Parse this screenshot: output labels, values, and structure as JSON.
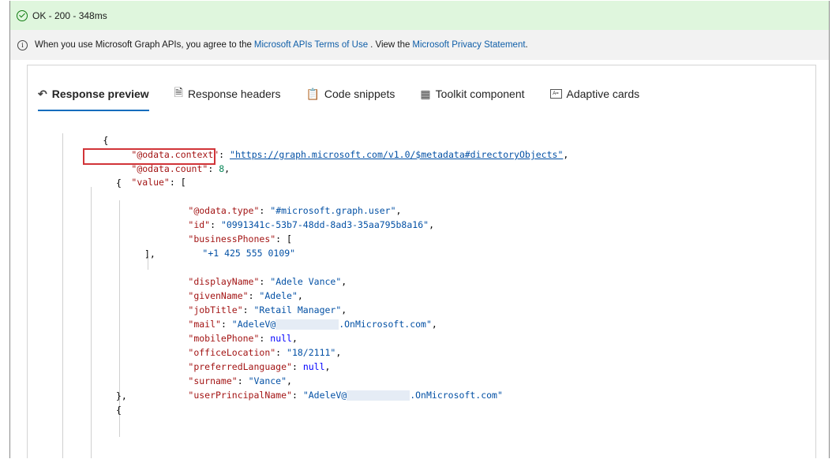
{
  "status": {
    "text": "OK - 200 - 348ms",
    "color": "#107c10"
  },
  "info": {
    "prefix": "When you use Microsoft Graph APIs, you agree to the",
    "terms_link": "Microsoft APIs Terms of Use",
    "mid": ". View the",
    "privacy_link": "Microsoft Privacy Statement",
    "suffix": "."
  },
  "tabs": [
    {
      "label": "Response preview",
      "icon": "undo-arrow-icon",
      "active": true
    },
    {
      "label": "Response headers",
      "icon": "document-gear-icon",
      "active": false
    },
    {
      "label": "Code snippets",
      "icon": "clipboard-code-icon",
      "active": false
    },
    {
      "label": "Toolkit component",
      "icon": "grid-icon",
      "active": false
    },
    {
      "label": "Adaptive cards",
      "icon": "card-icon",
      "active": false
    }
  ],
  "json": {
    "open_brace": "{",
    "context_key": "\"@odata.context\"",
    "context_val": "\"https://graph.microsoft.com/v1.0/$metadata#directoryObjects\"",
    "count_key": "\"@odata.count\"",
    "count_val": "8",
    "value_key": "\"value\"",
    "type_key": "\"@odata.type\"",
    "type_val": "\"#microsoft.graph.user\"",
    "id_key": "\"id\"",
    "id_val": "\"0991341c-53b7-48dd-8ad3-35aa795b8a16\"",
    "phones_key": "\"businessPhones\"",
    "phone_val": "\"+1 425 555 0109\"",
    "display_key": "\"displayName\"",
    "display_val": "\"Adele Vance\"",
    "given_key": "\"givenName\"",
    "given_val": "\"Adele\"",
    "job_key": "\"jobTitle\"",
    "job_val": "\"Retail Manager\"",
    "mail_key": "\"mail\"",
    "mail_val_start": "\"AdeleV@",
    "mail_val_end": ".OnMicrosoft.com\"",
    "mobile_key": "\"mobilePhone\"",
    "null_val": "null",
    "office_key": "\"officeLocation\"",
    "office_val": "\"18/2111\"",
    "lang_key": "\"preferredLanguage\"",
    "surname_key": "\"surname\"",
    "surname_val": "\"Vance\"",
    "upn_key": "\"userPrincipalName\"",
    "upn_val_start": "\"AdeleV@",
    "upn_val_end": ".OnMicrosoft.com\""
  }
}
